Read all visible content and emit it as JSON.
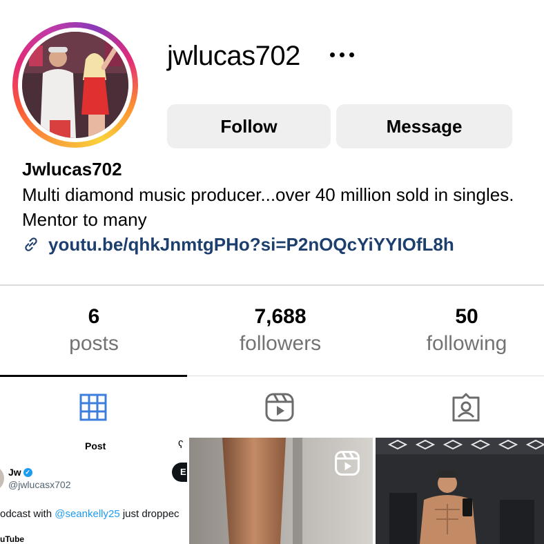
{
  "profile": {
    "username": "jwlucas702",
    "display_name": "Jwlucas702",
    "bio": "Multi diamond music producer...over 40 million sold in singles. Mentor to many",
    "link": "youtu.be/qhkJnmtgPHo?si=P2nOQcYiYYIOfL8h",
    "more_icon": "ellipsis-icon",
    "link_icon": "link-chain-icon"
  },
  "actions": {
    "follow_label": "Follow",
    "message_label": "Message"
  },
  "stats": {
    "posts_count": "6",
    "posts_label": "posts",
    "followers_count": "7,688",
    "followers_label": "followers",
    "following_count": "50",
    "following_label": "following"
  },
  "tabs": [
    {
      "name": "posts-grid",
      "icon": "grid-icon",
      "active": true
    },
    {
      "name": "reels",
      "icon": "reels-icon",
      "active": false
    },
    {
      "name": "tagged",
      "icon": "tagged-user-icon",
      "active": false
    }
  ],
  "posts": {
    "p1": {
      "title": "Post",
      "author": "Jw",
      "handle": "@jwlucasx702",
      "text_before": "odcast with ",
      "mention": "@seankelly25",
      "text_after": " just droppec",
      "footer": "uTube"
    },
    "p2": {
      "badge_icon": "reels-icon"
    }
  },
  "colors": {
    "link": "#1c3f6e",
    "muted": "#737373",
    "button_bg": "#efefef",
    "active_tab_icon": "#3d7ddb",
    "inactive_tab_icon": "#6b6b6b",
    "verified": "#1d9bf0"
  }
}
